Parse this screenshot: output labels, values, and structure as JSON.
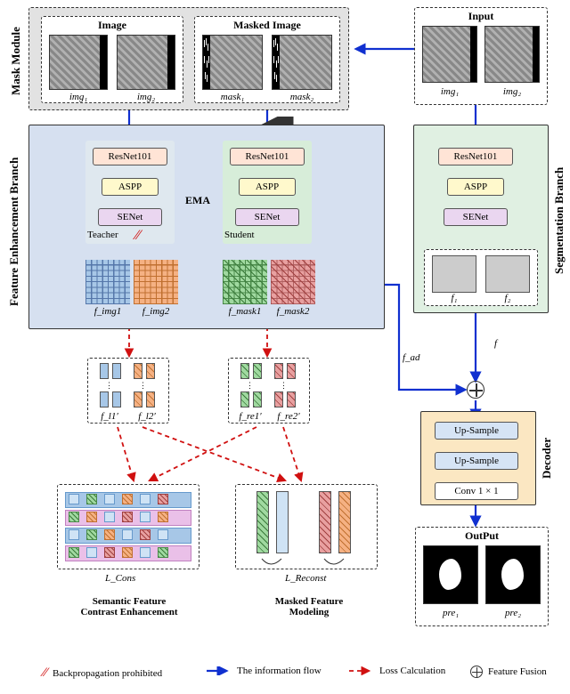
{
  "mask_module": {
    "vlabel": "Mask Module",
    "image_panel_title": "Image",
    "masked_panel_title": "Masked Image",
    "img1": "img₁",
    "img2": "img₂",
    "mask1": "mask₁",
    "mask2": "mask₂"
  },
  "input": {
    "title": "Input",
    "img1": "img₁",
    "img2": "img₂"
  },
  "feature_branch": {
    "vlabel": "Feature Enhancement Branch",
    "teacher": "Teacher",
    "student": "Student",
    "ema": "EMA",
    "resnet": "ResNet101",
    "aspp": "ASPP",
    "senet": "SENet",
    "f_img1": "f_img1",
    "f_img2": "f_img2",
    "f_mask1": "f_mask1",
    "f_mask2": "f_mask2",
    "no_backprop": "//"
  },
  "seg_branch": {
    "vlabel": "Segmentation Branch",
    "resnet": "ResNet101",
    "aspp": "ASPP",
    "senet": "SENet",
    "f1": "f₁",
    "f2": "f₂",
    "f": "f",
    "fad": "f_ad"
  },
  "decoder": {
    "vlabel": "Decoder",
    "upsample": "Up-Sample",
    "conv": "Conv 1 × 1"
  },
  "losses": {
    "fl1": "f_l1′",
    "fl2": "f_l2′",
    "fre1": "f_re1′",
    "fre2": "f_re2′",
    "lcons": "L_Cons",
    "lreconst": "L_Reconst",
    "semantic": "Semantic Feature\nContrast Enhancement",
    "masked": "Masked Feature\nModeling"
  },
  "output": {
    "title": "OutPut",
    "pre1": "pre₁",
    "pre2": "pre₂"
  },
  "legend": {
    "backprop": "Backpropagation prohibited",
    "flow": "The information flow",
    "loss": "Loss Calculation",
    "fusion": "Feature Fusion"
  },
  "colors": {
    "blue_arrow": "#1030d0",
    "red_arrow": "#d01010",
    "teacher_feat1": "#a7c7e7",
    "teacher_feat2": "#f5b183",
    "student_feat1": "#a0d9a0",
    "student_feat2": "#e8a0a0"
  }
}
